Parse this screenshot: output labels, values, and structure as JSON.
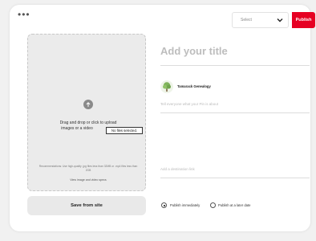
{
  "toolbar": {
    "more_label": "•••",
    "board_select": "Select",
    "publish_label": "Publish"
  },
  "upload": {
    "instruction_line1": "Drag and drop or click to upload",
    "instruction_line2": "images or a video",
    "file_status": "No files selected.",
    "recommendation": "Recommendations: Use high-quality .jpg files less than 32MB or .mp4 files less than 2GB",
    "specs_link": "View image and video specs"
  },
  "save_from_site_label": "Save from site",
  "form": {
    "title_placeholder": "Add your title",
    "account_name": "Tamarack Genealogy",
    "about_placeholder": "Tell everyone what your Pin is about",
    "link_placeholder": "Add a destination link"
  },
  "publish_options": {
    "immediately_label": "Publish immediately",
    "later_label": "Publish at a later date",
    "selected": "immediately"
  },
  "colors": {
    "accent": "#e60023",
    "dropzone": "#ebebeb",
    "background": "#f1f1f1"
  }
}
